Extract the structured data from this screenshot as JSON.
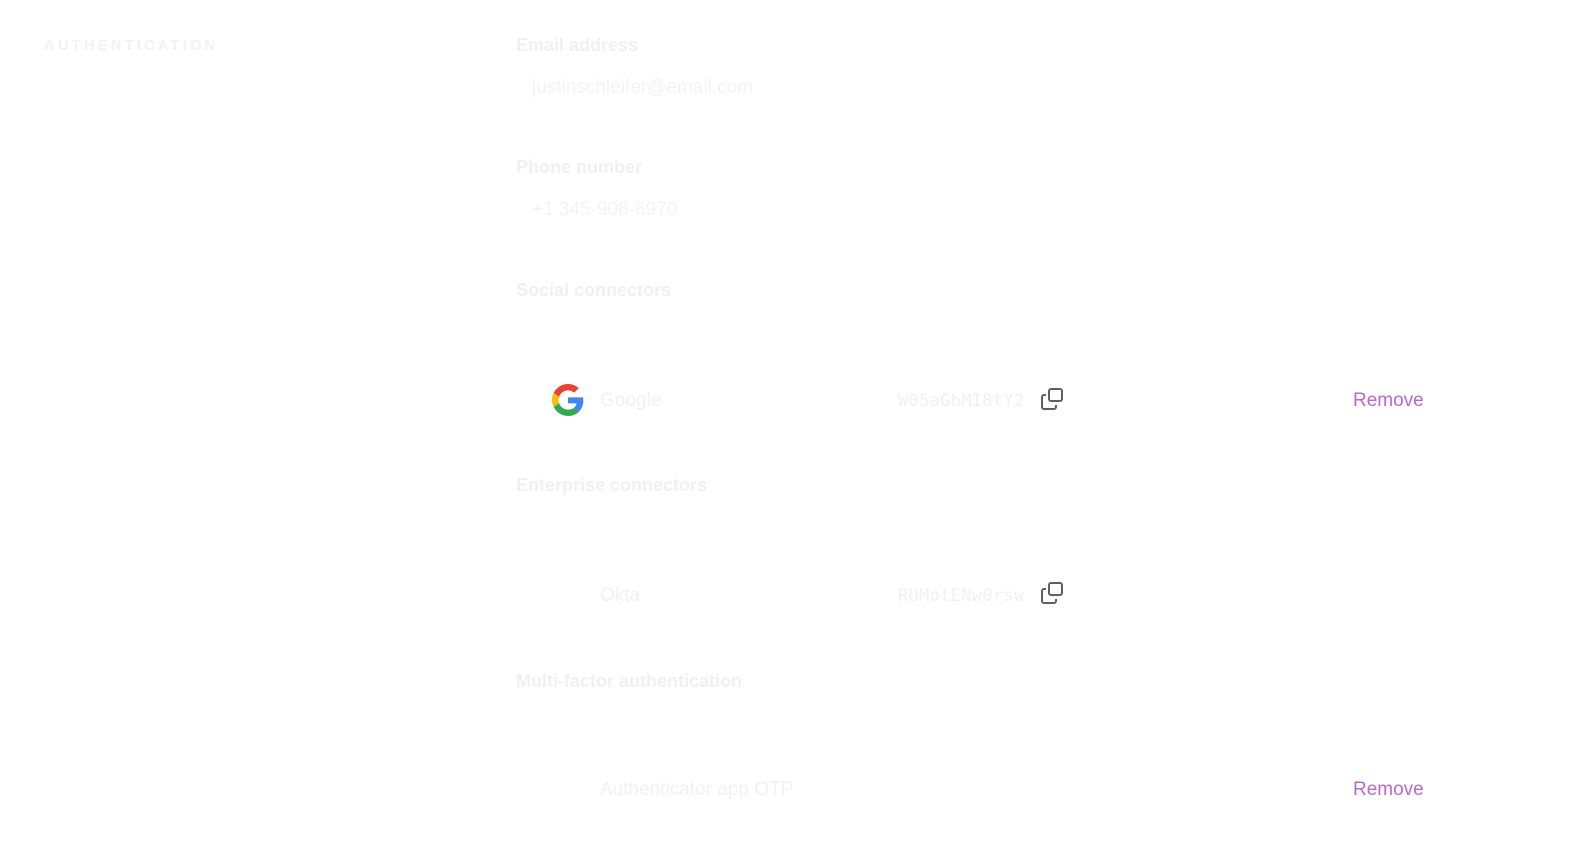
{
  "section": {
    "title": "AUTHENTICATION"
  },
  "email": {
    "label": "Email address",
    "value": "justinschleifer@email.com"
  },
  "phone": {
    "label": "Phone number",
    "value": "+1 345-908-8970"
  },
  "social": {
    "label": "Social connectors",
    "items": [
      {
        "name": "Google",
        "id": "W05aGbMI8tY2",
        "icon": "google-icon",
        "action": "Remove"
      }
    ]
  },
  "enterprise": {
    "label": "Enterprise connectors",
    "items": [
      {
        "name": "Okta",
        "id": "RUMotENw0rsw"
      }
    ]
  },
  "mfa": {
    "label": "Multi-factor authentication",
    "items": [
      {
        "name": "Authenticator app OTP",
        "action": "Remove"
      }
    ]
  },
  "colors": {
    "accent": "#b868cf",
    "copy_icon": "#5f5f5f"
  }
}
